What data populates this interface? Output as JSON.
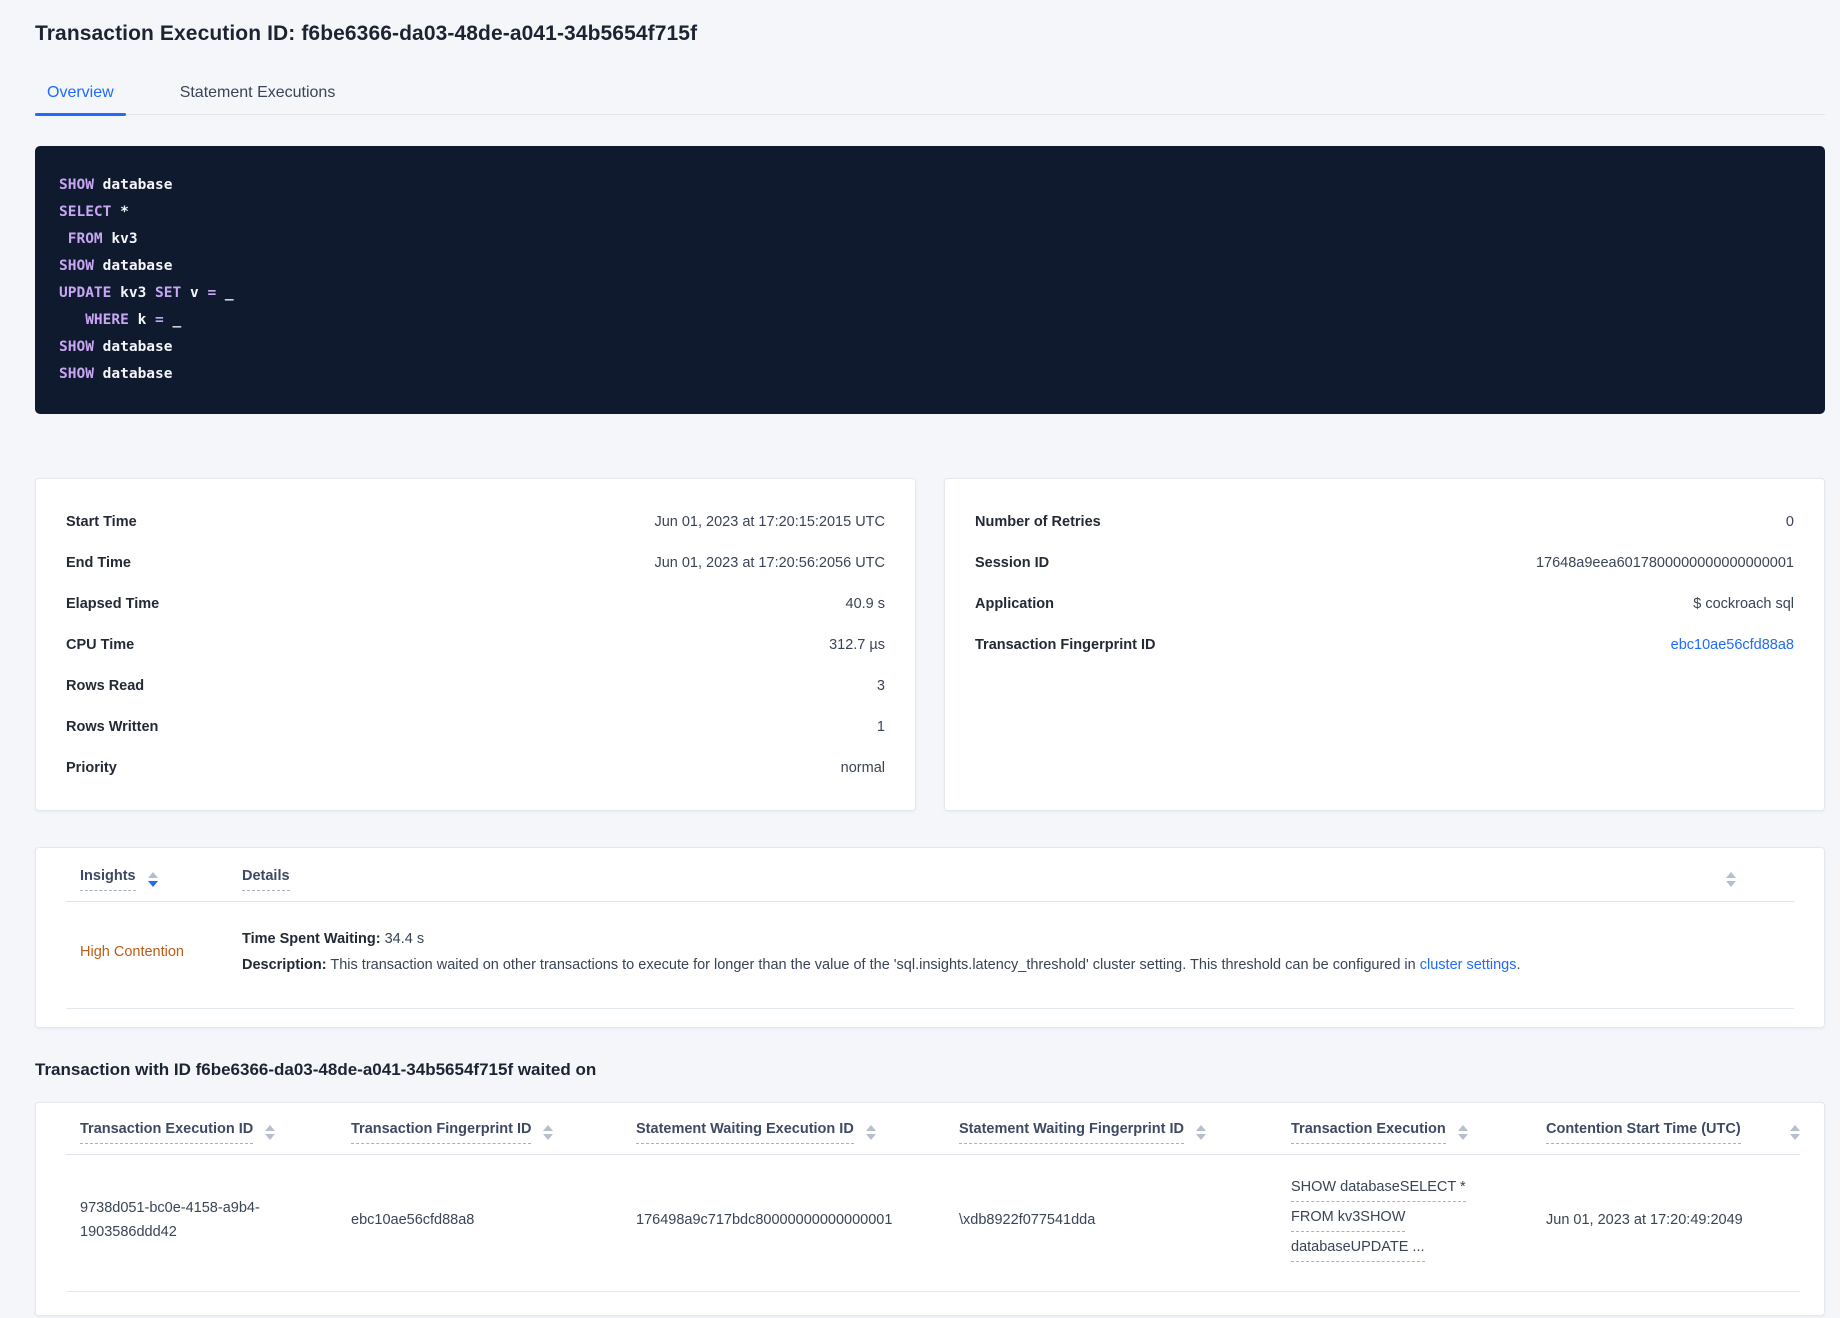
{
  "colors": {
    "accent_blue": "#1f6aff",
    "insight_orange": "#bd5c14",
    "code_background": "#0f1a2e",
    "code_keyword_purple": "#c7a6f2",
    "code_identifier_white": "#f4f5f9",
    "page_background": "#f4f6fa"
  },
  "icons": {
    "sort": "double-triangle-sort-icon"
  },
  "header": {
    "title": "Transaction Execution ID: f6be6366-da03-48de-a041-34b5654f715f",
    "tabs": [
      {
        "label": "Overview",
        "active": true
      },
      {
        "label": "Statement Executions",
        "active": false
      }
    ]
  },
  "sql": {
    "lines": [
      {
        "segments": [
          {
            "text": "SHOW",
            "kw": true
          },
          {
            "text": " database",
            "kw": false
          }
        ]
      },
      {
        "segments": [
          {
            "text": "SELECT",
            "kw": true
          },
          {
            "text": " *",
            "kw": false
          }
        ]
      },
      {
        "segments": [
          {
            "text": " FROM",
            "kw": true
          },
          {
            "text": " kv3",
            "kw": false
          }
        ]
      },
      {
        "segments": [
          {
            "text": "SHOW",
            "kw": true
          },
          {
            "text": " database",
            "kw": false
          }
        ]
      },
      {
        "segments": [
          {
            "text": "UPDATE",
            "kw": true
          },
          {
            "text": " kv3 ",
            "kw": false
          },
          {
            "text": "SET",
            "kw": true
          },
          {
            "text": " v ",
            "kw": false
          },
          {
            "text": "=",
            "kw": true
          },
          {
            "text": " _",
            "kw": false
          }
        ]
      },
      {
        "segments": [
          {
            "text": "   WHERE",
            "kw": true
          },
          {
            "text": " k ",
            "kw": false
          },
          {
            "text": "=",
            "kw": true
          },
          {
            "text": " _",
            "kw": false
          }
        ]
      },
      {
        "segments": [
          {
            "text": "SHOW",
            "kw": true
          },
          {
            "text": " database",
            "kw": false
          }
        ]
      },
      {
        "segments": [
          {
            "text": "SHOW",
            "kw": true
          },
          {
            "text": " database",
            "kw": false
          }
        ]
      }
    ]
  },
  "left_card": {
    "rows": [
      {
        "label": "Start Time",
        "value": "Jun 01, 2023 at 17:20:15:2015 UTC"
      },
      {
        "label": "End Time",
        "value": "Jun 01, 2023 at 17:20:56:2056 UTC"
      },
      {
        "label": "Elapsed Time",
        "value": "40.9 s"
      },
      {
        "label": "CPU Time",
        "value": "312.7 µs"
      },
      {
        "label": "Rows Read",
        "value": "3"
      },
      {
        "label": "Rows Written",
        "value": "1"
      },
      {
        "label": "Priority",
        "value": "normal"
      }
    ]
  },
  "right_card": {
    "rows": [
      {
        "label": "Number of Retries",
        "value": "0"
      },
      {
        "label": "Session ID",
        "value": "17648a9eea6017800000000000000001"
      },
      {
        "label": "Application",
        "value": "$ cockroach sql"
      },
      {
        "label": "Transaction Fingerprint ID",
        "value": "ebc10ae56cfd88a8"
      }
    ]
  },
  "insights": {
    "columns": [
      {
        "label": "Insights",
        "sorted": "desc"
      },
      {
        "label": "Details",
        "sorted": null
      }
    ],
    "row": {
      "insight": "High Contention",
      "time_label": "Time Spent Waiting:",
      "time_value": "34.4 s",
      "desc_label": "Description:",
      "desc_text": "This transaction waited on other transactions to execute for longer than the value of the 'sql.insights.latency_threshold' cluster setting. This threshold can be configured in ",
      "desc_link": "cluster settings",
      "desc_suffix": "."
    }
  },
  "waited": {
    "heading": "Transaction with ID f6be6366-da03-48de-a041-34b5654f715f waited on",
    "columns": [
      "Transaction Execution ID",
      "Transaction Fingerprint ID",
      "Statement Waiting Execution ID",
      "Statement Waiting Fingerprint ID",
      "Transaction Execution",
      "Contention Start Time (UTC)"
    ],
    "rows": [
      {
        "transaction_execution_id": "9738d051-bc0e-4158-a9b4-1903586ddd42",
        "transaction_fingerprint_id": "ebc10ae56cfd88a8",
        "statement_waiting_execution_id": "176498a9c717bdc80000000000000001",
        "statement_waiting_fingerprint_id": "\\xdb8922f077541dda",
        "transaction_execution_lines": [
          "SHOW databaseSELECT *",
          "FROM kv3SHOW",
          "databaseUPDATE ..."
        ],
        "contention_start_time": "Jun 01, 2023 at 17:20:49:2049"
      }
    ]
  }
}
